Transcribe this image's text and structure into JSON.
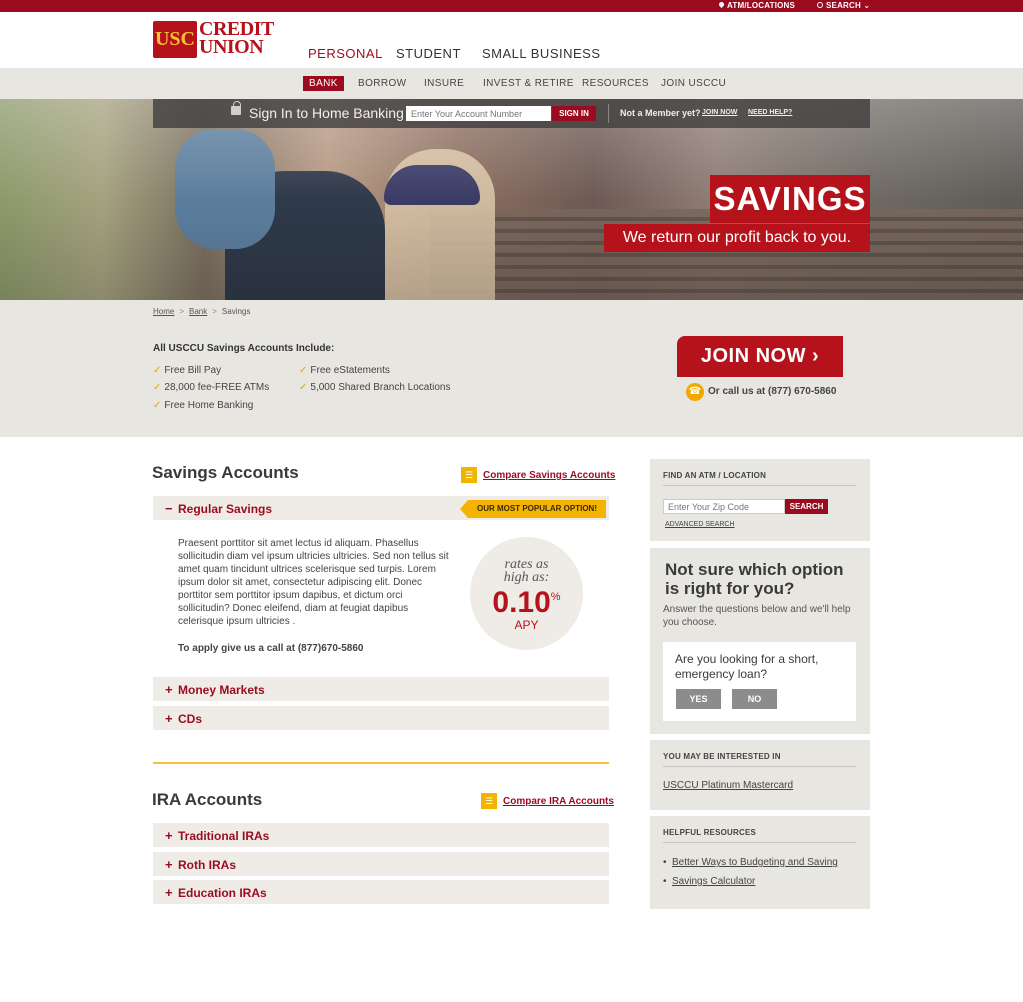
{
  "utility": {
    "atm": "ATM/LOCATIONS",
    "search": "SEARCH"
  },
  "logo": {
    "usc": "USC",
    "line1": "CREDIT",
    "line2": "UNION"
  },
  "main_nav": [
    "PERSONAL",
    "STUDENT",
    "SMALL BUSINESS"
  ],
  "sub_nav": [
    "BANK",
    "BORROW",
    "INSURE",
    "INVEST & RETIRE",
    "RESOURCES",
    "JOIN USCCU"
  ],
  "signin": {
    "title": "Sign In to Home Banking",
    "placeholder": "Enter Your Account Number",
    "button": "SIGN IN",
    "member_q": "Not a Member yet?",
    "join": "JOIN NOW",
    "help": "NEED HELP?"
  },
  "hero": {
    "title": "SAVINGS",
    "subtitle": "We return our profit back to you."
  },
  "breadcrumb": {
    "home": "Home",
    "sep": ">",
    "bank": "Bank",
    "current": "Savings"
  },
  "includes": {
    "title": "All USCCU Savings Accounts Include:",
    "check": "✓",
    "items": [
      "Free Bill Pay",
      "28,000 fee-FREE ATMs",
      "Free Home Banking",
      "Free eStatements",
      "5,000 Shared Branch Locations"
    ]
  },
  "join_button": "JOIN NOW",
  "call": "Or call us at (877) 670-5860",
  "savings": {
    "title": "Savings Accounts",
    "compare": "Compare Savings Accounts",
    "regular": {
      "label": "Regular Savings",
      "badge": "OUR MOST POPULAR OPTION!",
      "body": "Praesent porttitor sit amet lectus id aliquam. Phasellus sollicitudin diam vel ipsum ultricies ultricies. Sed non tellus sit amet quam tincidunt ultrices scelerisque sed turpis. Lorem ipsum dolor sit amet, consectetur adipiscing elit. Donec porttitor sem porttitor ipsum dapibus, et dictum orci sollicitudin? Donec eleifend, diam at feugiat dapibus celerisque ipsum ultricies .",
      "apply": "To apply give us a call at (877)670-5860",
      "rate_line1": "rates as",
      "rate_line2": "high as:",
      "rate": "0.10",
      "rate_unit": "%",
      "apy": "APY"
    },
    "others": [
      "Money Markets",
      "CDs"
    ]
  },
  "ira": {
    "title": "IRA Accounts",
    "compare": "Compare IRA Accounts",
    "items": [
      "Traditional IRAs",
      "Roth IRAs",
      "Education IRAs"
    ]
  },
  "sidebar": {
    "atm": {
      "head": "FIND AN ATM / LOCATION",
      "placeholder": "Enter Your Zip Code",
      "button": "SEARCH",
      "advanced": "ADVANCED SEARCH"
    },
    "question": {
      "title": "Not sure which option is right for you?",
      "sub": "Answer the questions below and we'll help you choose.",
      "q": "Are you looking for a short, emergency loan?",
      "yes": "YES",
      "no": "NO"
    },
    "interest": {
      "head": "YOU MAY BE INTERESTED IN",
      "link": "USCCU Platinum Mastercard"
    },
    "resources": {
      "head": "HELPFUL RESOURCES",
      "bullet": "•",
      "links": [
        "Better Ways to Budgeting and Saving",
        "Savings Calculator"
      ]
    }
  }
}
